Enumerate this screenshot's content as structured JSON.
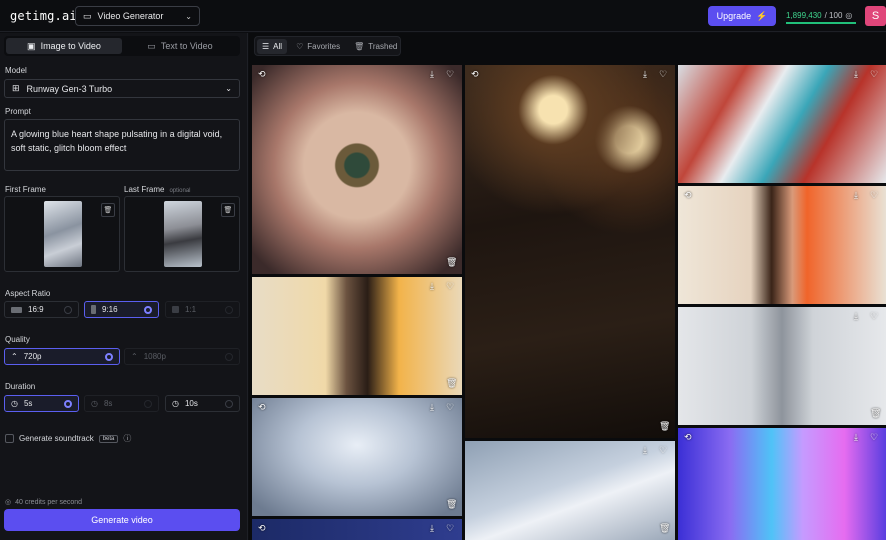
{
  "header": {
    "logo": "getimg.ai",
    "tool_label": "Video Generator",
    "upgrade_label": "Upgrade",
    "credits_value": "1,899,430",
    "credits_total": "/ 100",
    "avatar_letter": "S"
  },
  "left": {
    "tabs": [
      "Image to Video",
      "Text to Video"
    ],
    "model_label": "Model",
    "model_value": "Runway Gen-3 Turbo",
    "prompt_label": "Prompt",
    "prompt_text": "A glowing blue heart shape pulsating in a digital void, soft static, glitch bloom effect",
    "first_frame_label": "First Frame",
    "last_frame_label": "Last Frame",
    "last_frame_optional": "optional",
    "aspect_label": "Aspect Ratio",
    "aspect_options": [
      "16:9",
      "9:16",
      "1:1"
    ],
    "quality_label": "Quality",
    "quality_options": [
      "720p",
      "1080p"
    ],
    "duration_label": "Duration",
    "duration_options": [
      "5s",
      "8s",
      "10s"
    ],
    "soundtrack_label": "Generate soundtrack",
    "beta": "beta",
    "credits_info": "40 credits per second",
    "generate_label": "Generate video"
  },
  "gallery": {
    "filters": [
      "All",
      "Favorites",
      "Trashed"
    ]
  },
  "colors": {
    "accent": "#5b4ef0",
    "credits_green": "#3fd58e",
    "avatar": "#e0467a"
  }
}
